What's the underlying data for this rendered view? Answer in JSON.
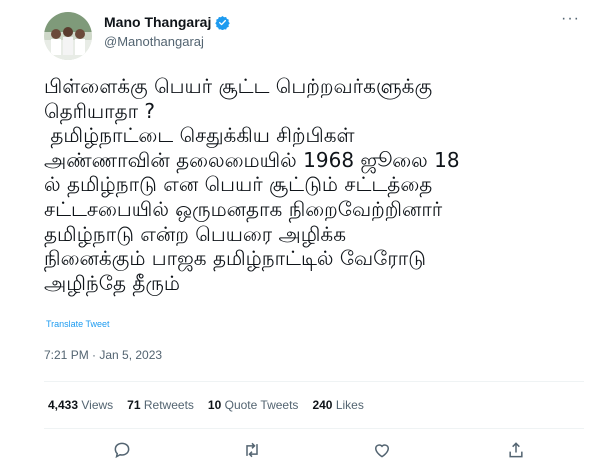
{
  "tweet": {
    "author_name": "Mano Thangaraj",
    "author_handle": "@Manothangaraj",
    "more_label": "···",
    "text_lines": [
      "பிள்ளைக்கு பெயர் சூட்ட பெற்றவர்களுக்கு",
      "தெரியாதா ?",
      " தமிழ்நாட்டை செதுக்கிய சிற்பிகள்",
      "அண்ணாவின் தலைமையில் 1968 ஜூலை 18",
      "ல் தமிழ்நாடு என பெயர் சூட்டும் சட்டத்தை",
      "சட்டசபையில் ஒருமனதாக நிறைவேற்றினார்",
      "தமிழ்நாடு என்ற பெயரை அழிக்க",
      "நினைக்கும் பாஜக தமிழ்நாட்டில் வேரோடு",
      "அழிந்தே தீரும்"
    ],
    "translate_label": "Translate Tweet",
    "timestamp": "7:21 PM · Jan 5, 2023",
    "stats": {
      "views_count": "4,433",
      "views_label": "Views",
      "retweets_count": "71",
      "retweets_label": "Retweets",
      "quotes_count": "10",
      "quotes_label": "Quote Tweets",
      "likes_count": "240",
      "likes_label": "Likes"
    }
  },
  "colors": {
    "accent": "#1d9bf0",
    "text": "#0f1419",
    "muted": "#536471"
  }
}
